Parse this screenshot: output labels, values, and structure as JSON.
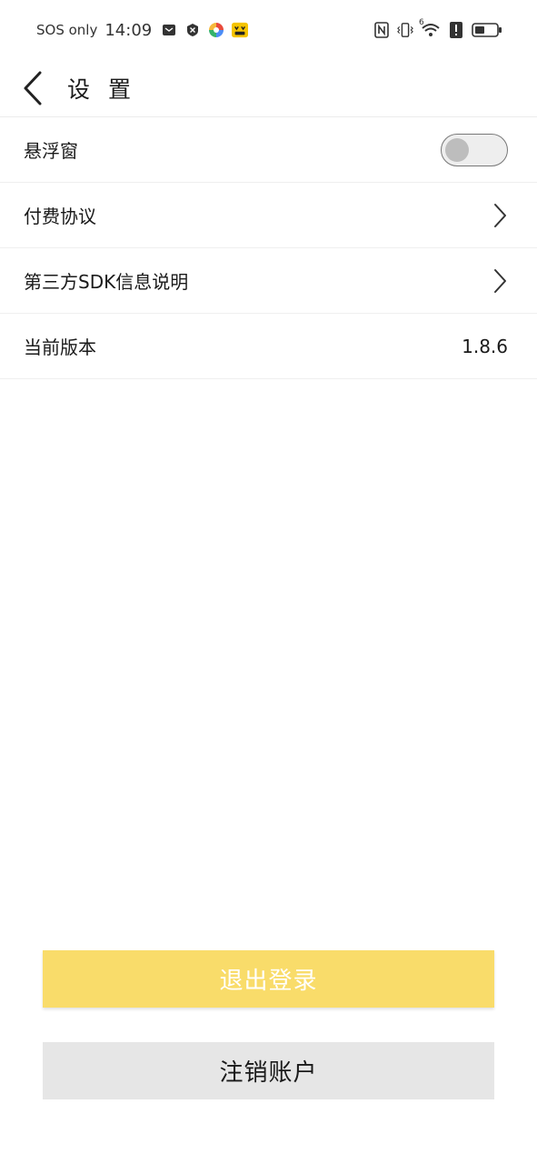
{
  "status_bar": {
    "carrier": "SOS only",
    "time": "14:09",
    "icons": [
      "message-icon",
      "shield-x-icon",
      "pinwheel-icon",
      "app-face-icon"
    ],
    "right_icons": [
      "nfc-icon",
      "vibrate-icon",
      "wifi-icon",
      "alert-icon",
      "battery-icon"
    ],
    "wifi_label": "6"
  },
  "header": {
    "title": "设 置"
  },
  "settings": {
    "floating_window": {
      "label": "悬浮窗",
      "enabled": false
    },
    "payment_agreement": {
      "label": "付费协议"
    },
    "third_party_sdk": {
      "label": "第三方SDK信息说明"
    },
    "current_version": {
      "label": "当前版本",
      "value": "1.8.6"
    }
  },
  "actions": {
    "logout_label": "退出登录",
    "cancel_account_label": "注销账户"
  },
  "colors": {
    "accent": "#f9dc6a",
    "secondary_button": "#e6e6e6"
  }
}
